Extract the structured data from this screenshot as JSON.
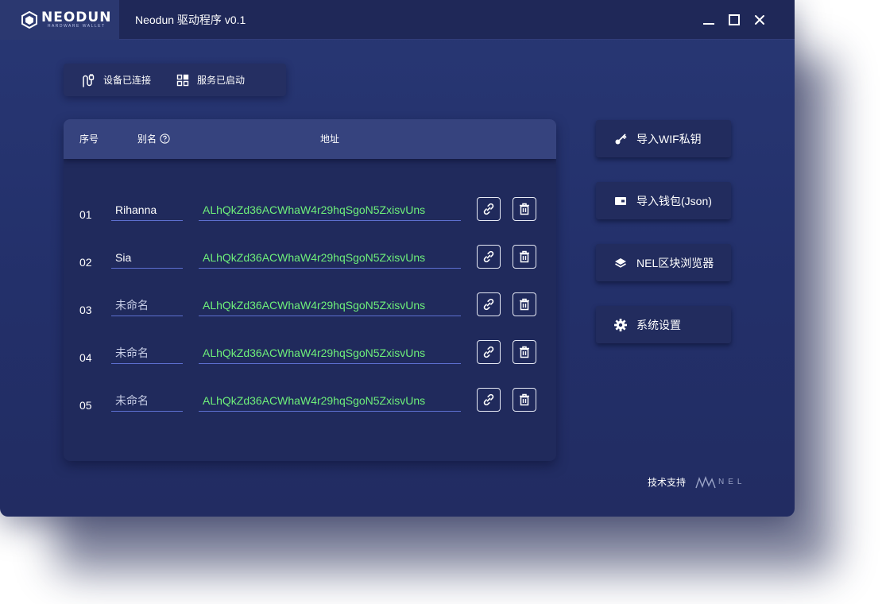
{
  "app": {
    "logo_text": "NEODUN",
    "logo_subtext": "HARDWARE WALLET",
    "title": "Neodun 驱动程序 v0.1"
  },
  "window_controls": {
    "minimize_icon": "minimize-icon",
    "maximize_icon": "maximize-icon",
    "close_icon": "close-icon"
  },
  "status": {
    "device": {
      "label": "设备已连接",
      "icon": "usb-plug-icon"
    },
    "service": {
      "label": "服务已启动",
      "icon": "grid-apps-icon"
    }
  },
  "table": {
    "headers": {
      "index": "序号",
      "alias": "别名",
      "address": "地址"
    },
    "rows": [
      {
        "index": "01",
        "alias": "Rihanna",
        "alias_placeholder": false,
        "address": "ALhQkZd36ACWhaW4r29hqSgoN5ZxisvUns"
      },
      {
        "index": "02",
        "alias": "Sia",
        "alias_placeholder": false,
        "address": "ALhQkZd36ACWhaW4r29hqSgoN5ZxisvUns"
      },
      {
        "index": "03",
        "alias": "未命名",
        "alias_placeholder": true,
        "address": "ALhQkZd36ACWhaW4r29hqSgoN5ZxisvUns"
      },
      {
        "index": "04",
        "alias": "未命名",
        "alias_placeholder": true,
        "address": "ALhQkZd36ACWhaW4r29hqSgoN5ZxisvUns"
      },
      {
        "index": "05",
        "alias": "未命名",
        "alias_placeholder": true,
        "address": "ALhQkZd36ACWhaW4r29hqSgoN5ZxisvUns"
      }
    ]
  },
  "actions": [
    {
      "label": "导入WIF私钥",
      "icon": "key-icon"
    },
    {
      "label": "导入钱包(Json)",
      "icon": "wallet-icon"
    },
    {
      "label": "NEL区块浏览器",
      "icon": "layers-icon"
    },
    {
      "label": "系统设置",
      "icon": "gear-icon"
    }
  ],
  "footer": {
    "support_label": "技术支持",
    "partner_logo_text": "NEL"
  },
  "colors": {
    "address_text": "#6ef07a",
    "window_bg": "#283774",
    "field_underline": "#5d6fd0"
  }
}
